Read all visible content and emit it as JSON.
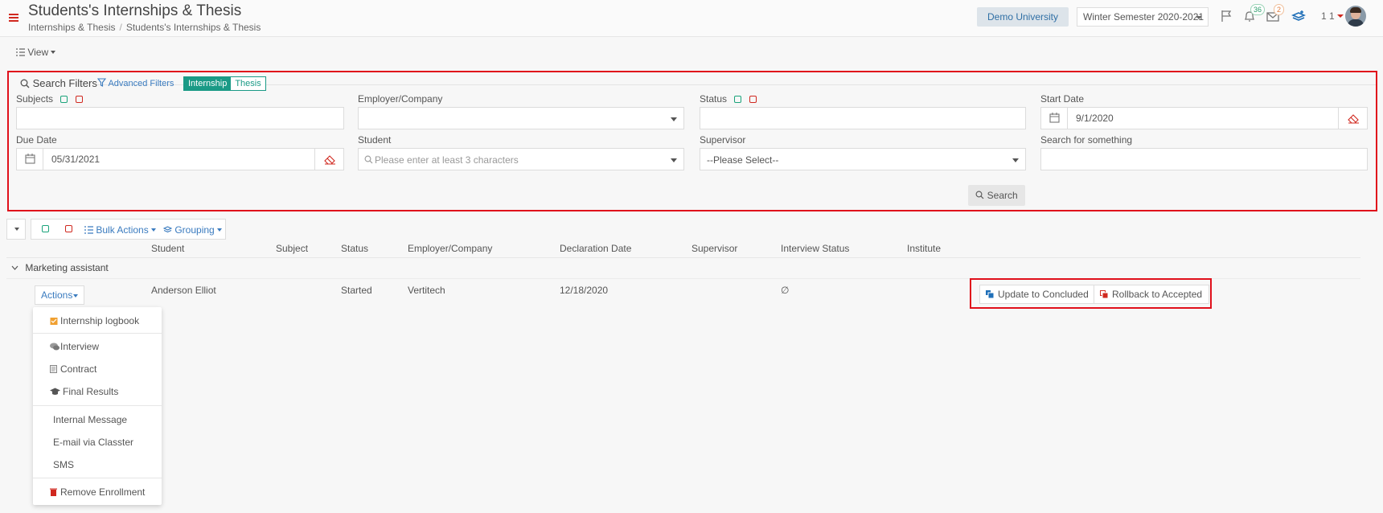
{
  "header": {
    "title": "Students's Internships & Thesis",
    "breadcrumb": [
      "Internships & Thesis",
      "Students's Internships & Thesis"
    ],
    "university": "Demo University",
    "semester": "Winter Semester 2020-2021",
    "notifications_count": "36",
    "messages_count": "2",
    "user_label": "1 1"
  },
  "toolbar": {
    "view_label": "View"
  },
  "filters": {
    "title": "Search Filters",
    "advanced_label": "Advanced Filters",
    "toggle": [
      "Internship",
      "Thesis"
    ],
    "subjects_label": "Subjects",
    "employer_label": "Employer/Company",
    "status_label": "Status",
    "start_date_label": "Start Date",
    "start_date_value": "9/1/2020",
    "due_date_label": "Due Date",
    "due_date_value": "05/31/2021",
    "student_label": "Student",
    "student_placeholder": "Please enter at least 3 characters",
    "supervisor_label": "Supervisor",
    "supervisor_value": "--Please Select--",
    "search_something_label": "Search for something",
    "search_button": "Search"
  },
  "table_toolbar": {
    "bulk_actions": "Bulk Actions",
    "grouping": "Grouping"
  },
  "table": {
    "columns": [
      "Student",
      "Subject",
      "Status",
      "Employer/Company",
      "Declaration Date",
      "Supervisor",
      "Interview Status",
      "Institute"
    ],
    "group": "Marketing assistant",
    "row": {
      "actions_label": "Actions",
      "student": "Anderson Elliot",
      "subject": "",
      "status": "Started",
      "employer": "Vertitech",
      "declaration_date": "12/18/2020",
      "supervisor": "",
      "interview_status": "∅",
      "institute": ""
    },
    "status_buttons": {
      "concluded": "Update to Concluded",
      "rollback": "Rollback to Accepted"
    }
  },
  "actions_menu": {
    "items": [
      "Internship logbook",
      "Interview",
      "Contract",
      "Final Results",
      "Internal Message",
      "E-mail via Classter",
      "SMS",
      "Remove Enrollment"
    ]
  },
  "colors": {
    "accent_red": "#d0281f",
    "highlight_red": "#e0101b",
    "link_blue": "#3a7bbf",
    "teal": "#1a9a86"
  }
}
